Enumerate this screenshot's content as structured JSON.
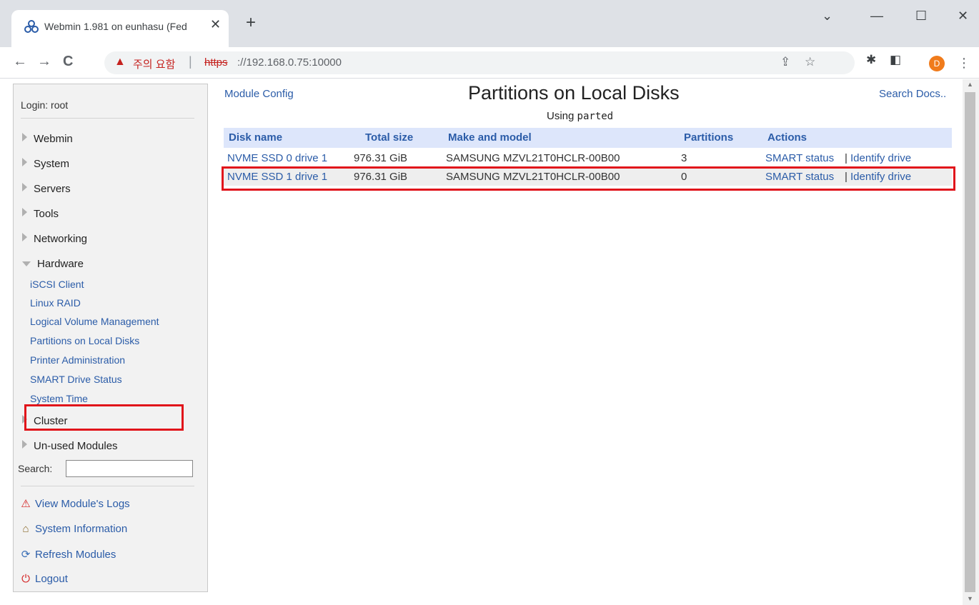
{
  "browser": {
    "tab_title": "Webmin 1.981 on eunhasu (Fed",
    "tab_close": "✕",
    "new_tab": "+",
    "window_controls": {
      "dropdown": "⌄",
      "minimize": "—",
      "maximize": "☐",
      "close": "✕"
    },
    "nav": {
      "back": "←",
      "forward": "→",
      "reload": "C"
    },
    "security_warning": "주의 요함",
    "url_separator": "|",
    "url_scheme": "https",
    "url_rest": "://192.168.0.75:10000",
    "share_icon": "⇪",
    "star_icon": "☆",
    "extensions_icon": "✱",
    "sidepanel_icon": "◧",
    "profile_initial": "D",
    "menu_icon": "⋮"
  },
  "sidebar": {
    "login": "Login: root",
    "categories": {
      "webmin": "Webmin",
      "system": "System",
      "servers": "Servers",
      "tools": "Tools",
      "networking": "Networking",
      "hardware": "Hardware",
      "cluster": "Cluster",
      "unused": "Un-used Modules"
    },
    "hardware_modules": [
      "iSCSI Client",
      "Linux RAID",
      "Logical Volume Management",
      "Partitions on Local Disks",
      "Printer Administration",
      "SMART Drive Status",
      "System Time"
    ],
    "search_label": "Search:",
    "search_value": "",
    "links": {
      "logs": "View Module's Logs",
      "sysinfo": "System Information",
      "refresh": "Refresh Modules",
      "logout": "Logout"
    }
  },
  "main": {
    "module_config": "Module Config",
    "search_docs": "Search Docs..",
    "title": "Partitions on Local Disks",
    "subtitle_prefix": "Using",
    "subtitle_tool": "parted",
    "table": {
      "headers": [
        "Disk name",
        "Total size",
        "Make and model",
        "Partitions",
        "Actions"
      ],
      "rows": [
        {
          "disk": "NVME SSD 0 drive 1",
          "size": "976.31 GiB",
          "model": "SAMSUNG MZVL21T0HCLR-00B00",
          "partitions": "3",
          "smart": "SMART status",
          "sep": "|",
          "identify": "Identify drive"
        },
        {
          "disk": "NVME SSD 1 drive 1",
          "size": "976.31 GiB",
          "model": "SAMSUNG MZVL21T0HCLR-00B00",
          "partitions": "0",
          "smart": "SMART status",
          "sep": "|",
          "identify": "Identify drive"
        }
      ]
    }
  },
  "colors": {
    "link": "#2b5ca8",
    "highlight": "#e1151b",
    "header_bg": "#dde6fb",
    "selected_row_bg": "#eeeeee"
  }
}
